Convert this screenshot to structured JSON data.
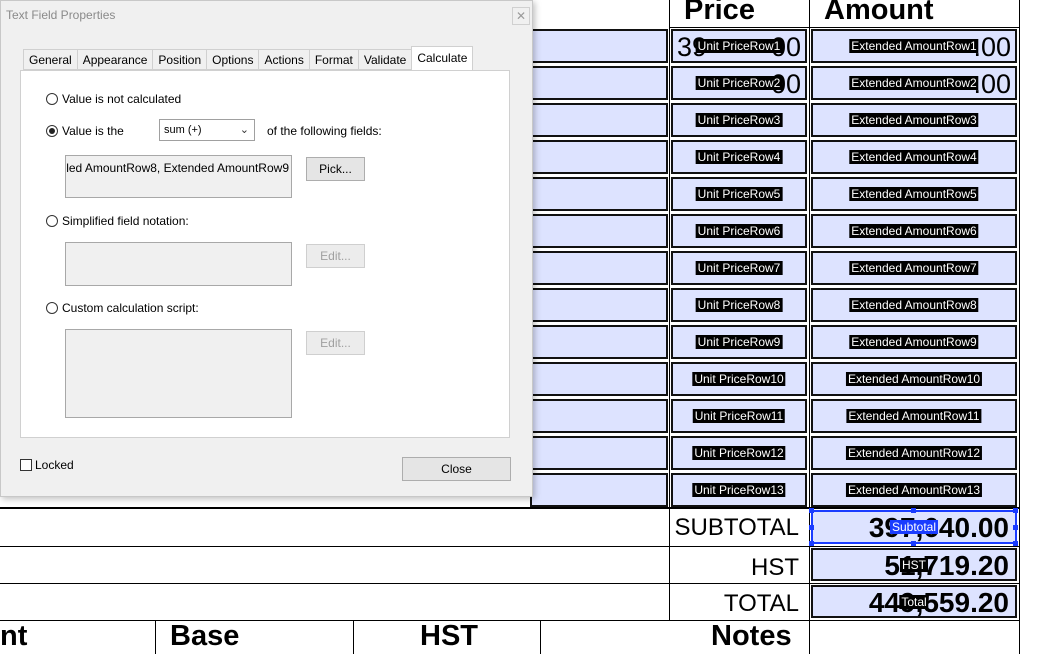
{
  "dialog": {
    "title": "Text Field Properties",
    "close_x": "✕",
    "tabs": [
      {
        "label": "General"
      },
      {
        "label": "Appearance"
      },
      {
        "label": "Position"
      },
      {
        "label": "Options"
      },
      {
        "label": "Actions"
      },
      {
        "label": "Format"
      },
      {
        "label": "Validate"
      },
      {
        "label": "Calculate"
      }
    ],
    "active_tab": "Calculate",
    "not_calculated_label": "Value is not calculated",
    "value_is_label": "Value is the",
    "operation_value": "sum (+)",
    "of_fields_label": "of the following fields:",
    "fields_value": "led AmountRow8, Extended AmountRow9",
    "pick_label": "Pick...",
    "simplified_label": "Simplified field notation:",
    "edit_label": "Edit...",
    "custom_label": "Custom calculation script:",
    "locked_label": "Locked",
    "close_label": "Close",
    "selected_option": "value_is"
  },
  "form": {
    "col_price": "Price",
    "col_amount": "Amount",
    "row1_price_ghost": "39",
    "row1_price_ghost_end": "00",
    "row1_amount_ghost_end": ".00",
    "row2_price_ghost": "00",
    "row2_amount_ghost": ".00",
    "rows": [
      {
        "unit": "Unit PriceRow1",
        "ext": "Extended AmountRow1"
      },
      {
        "unit": "Unit PriceRow2",
        "ext": "Extended AmountRow2"
      },
      {
        "unit": "Unit PriceRow3",
        "ext": "Extended AmountRow3"
      },
      {
        "unit": "Unit PriceRow4",
        "ext": "Extended AmountRow4"
      },
      {
        "unit": "Unit PriceRow5",
        "ext": "Extended AmountRow5"
      },
      {
        "unit": "Unit PriceRow6",
        "ext": "Extended AmountRow6"
      },
      {
        "unit": "Unit PriceRow7",
        "ext": "Extended AmountRow7"
      },
      {
        "unit": "Unit PriceRow8",
        "ext": "Extended AmountRow8"
      },
      {
        "unit": "Unit PriceRow9",
        "ext": "Extended AmountRow9"
      },
      {
        "unit": "Unit PriceRow10",
        "ext": "Extended AmountRow10"
      },
      {
        "unit": "Unit PriceRow11",
        "ext": "Extended AmountRow11"
      },
      {
        "unit": "Unit PriceRow12",
        "ext": "Extended AmountRow12"
      },
      {
        "unit": "Unit PriceRow13",
        "ext": "Extended AmountRow13"
      }
    ],
    "subtotal_label": "SUBTOTAL",
    "subtotal_value": "397,640.00",
    "subtotal_tag": "Subtotal",
    "hst_label": "HST",
    "hst_value": "51,719.20",
    "hst_tag": "HST",
    "total_label": "TOTAL",
    "total_value": "449,559.20",
    "total_tag": "Total",
    "bottom_headers": [
      "nt",
      "Base",
      "HST",
      "Notes"
    ]
  },
  "colors": {
    "field_fill": "#dde3ff",
    "selection": "#1a3cff",
    "dialog_bg": "#f0f0f0"
  }
}
